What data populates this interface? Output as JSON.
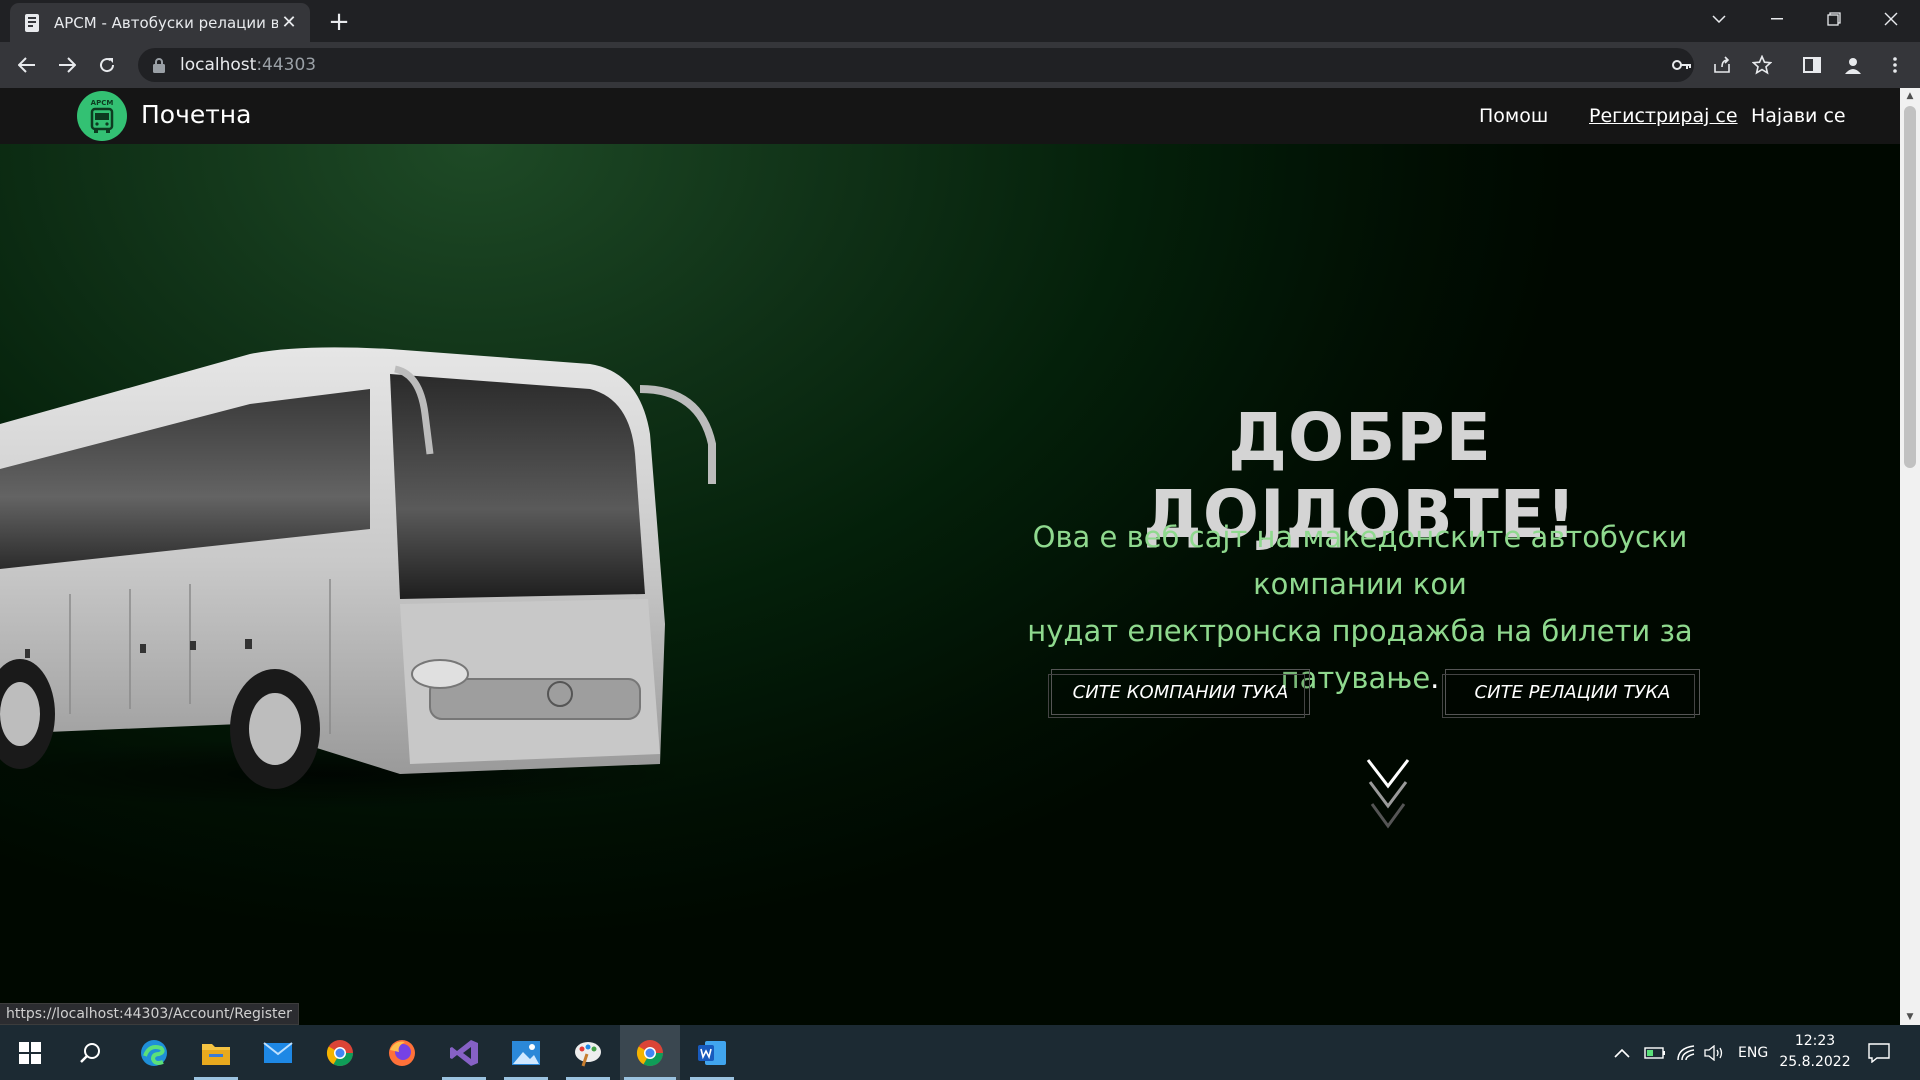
{
  "browser": {
    "tab_title": "АРСМ - Автобуски релации во (",
    "url_host": "localhost",
    "url_port": ":44303",
    "status_url": "https://localhost:44303/Account/Register"
  },
  "site": {
    "logo_text": "АРСМ",
    "brand": "Почетна",
    "nav": {
      "help": "Помош",
      "register": "Регистрирај се",
      "login": "Најави се"
    }
  },
  "hero": {
    "title": "ДОБРЕ ДОЈДОВТЕ!",
    "subtitle_line1": "Ова е веб сајт на македонските автобуски компании кои",
    "subtitle_line2": "нудат електронска продажба на билети за патување",
    "subtitle_end": ".",
    "btn_companies": "СИТЕ КОМПАНИИ ТУКА",
    "btn_routes": "СИТЕ РЕЛАЦИИ ТУКА"
  },
  "taskbar": {
    "lang": "ENG",
    "time": "12:23",
    "date": "25.8.2022",
    "apps": [
      "start-icon",
      "search-icon",
      "edge-icon",
      "file-explorer-icon",
      "mail-icon",
      "chrome-icon",
      "firefox-icon",
      "visual-studio-icon",
      "photos-icon",
      "paint-icon",
      "chrome-active-icon",
      "word-icon"
    ]
  },
  "colors": {
    "accent_green": "#33c173",
    "subtitle_green": "#8fd98e",
    "nav_bg": "#151515"
  }
}
